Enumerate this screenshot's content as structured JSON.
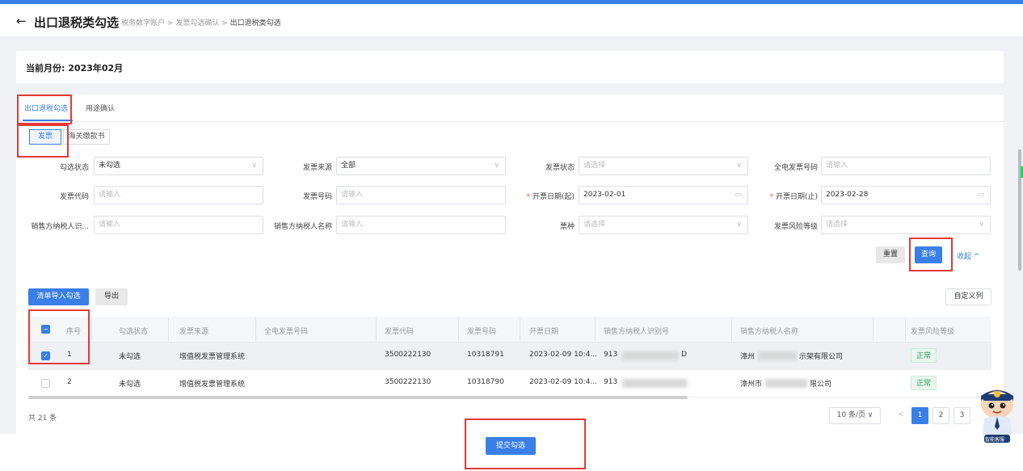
{
  "header": {
    "back_icon": "←",
    "title": "出口退税类勾选",
    "crumbs": [
      "税务数字账户",
      "发票勾选确认",
      "出口退税类勾选"
    ],
    "sep": ">"
  },
  "month": {
    "label": "当前月份:",
    "value": "2023年02月"
  },
  "tabs": [
    {
      "label": "出口退税勾选",
      "active": true
    },
    {
      "label": "用途确认",
      "active": false
    }
  ],
  "subtabs": [
    {
      "label": "发票",
      "active": true
    },
    {
      "label": "海关缴款书",
      "active": false
    }
  ],
  "filters": {
    "check_status": {
      "label": "勾选状态",
      "value": "未勾选"
    },
    "invoice_source": {
      "label": "发票来源",
      "value": "全部"
    },
    "invoice_status": {
      "label": "发票状态",
      "placeholder": "请选择"
    },
    "full_elec_no": {
      "label": "全电发票号码",
      "placeholder": "请输入"
    },
    "invoice_code": {
      "label": "发票代码",
      "placeholder": "请输入"
    },
    "invoice_no": {
      "label": "发票号码",
      "placeholder": "请输入"
    },
    "date_start": {
      "required": "*",
      "label": "开票日期(起)",
      "value": "2023-02-01"
    },
    "date_end": {
      "required": "*",
      "label": "开票日期(止)",
      "value": "2023-02-28"
    },
    "seller_tax_id": {
      "label": "销售方纳税人识...",
      "placeholder": "请输入"
    },
    "seller_name": {
      "label": "销售方纳税人名称",
      "placeholder": "请输入"
    },
    "invoice_type": {
      "label": "票种",
      "placeholder": "请选择"
    },
    "risk_level": {
      "label": "发票风险等级",
      "placeholder": "请选择"
    }
  },
  "actions": {
    "reset": "重置",
    "search": "查询",
    "collapse": "收起 ^"
  },
  "toolbar": {
    "import": "清单导入勾选",
    "export": "导出",
    "custom_cols": "自定义列"
  },
  "table": {
    "columns": [
      "序号",
      "勾选状态",
      "发票来源",
      "全电发票号码",
      "发票代码",
      "发票号码",
      "开票日期",
      "销售方纳税人识别号",
      "销售方纳税人名称",
      "发票风险等级"
    ],
    "rows": [
      {
        "checked": true,
        "no": "1",
        "status": "未勾选",
        "source": "增值税发票管理系统",
        "elec_no": "",
        "code": "3500222130",
        "number": "10318791",
        "date": "2023-02-09 10:4...",
        "tax_id_a": "913",
        "tax_id_b": "D",
        "name_a": "漳州",
        "name_b": "示架有限公司",
        "risk": "正常"
      },
      {
        "checked": false,
        "no": "2",
        "status": "未勾选",
        "source": "增值税发票管理系统",
        "elec_no": "",
        "code": "3500222130",
        "number": "10318790",
        "date": "2023-02-09 10:4...",
        "tax_id_a": "913",
        "tax_id_b": "",
        "name_a": "漳州市",
        "name_b": "限公司",
        "risk": "正常"
      }
    ]
  },
  "pagination": {
    "total": "共 21 条",
    "page_size": "10 条/页 ∨",
    "prev": "<",
    "pages": [
      "1",
      "2",
      "3"
    ]
  },
  "footer": {
    "submit": "提交勾选"
  },
  "mascot": {
    "caption": "智能客服"
  },
  "colors": {
    "accent": "#3a7ee8",
    "highlight": "#e53935",
    "ok": "#2e9e5b"
  }
}
